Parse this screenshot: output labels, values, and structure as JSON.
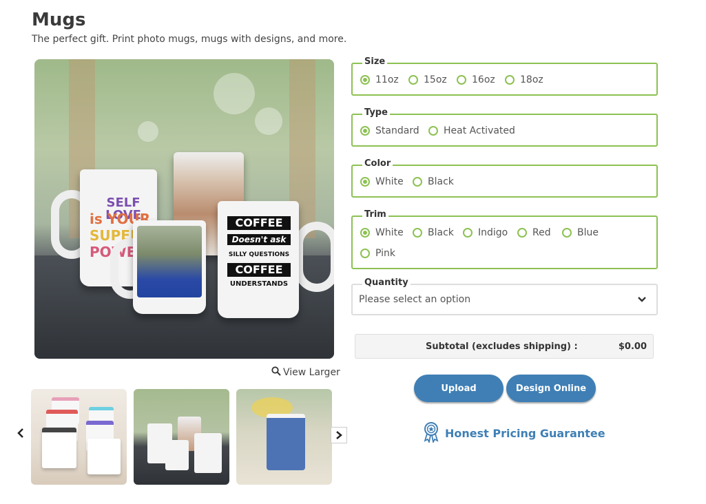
{
  "page": {
    "title": "Mugs",
    "subtitle": "The perfect gift. Print photo mugs, mugs with designs, and more."
  },
  "gallery": {
    "view_larger": "View Larger",
    "main_mug_texts": {
      "self_love": [
        "SELF LOVE",
        "is YOUR",
        "SUPER",
        "POWER"
      ],
      "coffee": [
        "COFFEE",
        "Doesn't ask",
        "SILLY QUESTIONS",
        "COFFEE",
        "UNDERSTANDS"
      ]
    }
  },
  "options": {
    "size": {
      "legend": "Size",
      "items": [
        "11oz",
        "15oz",
        "16oz",
        "18oz"
      ],
      "selected": "11oz"
    },
    "type": {
      "legend": "Type",
      "items": [
        "Standard",
        "Heat Activated"
      ],
      "selected": "Standard"
    },
    "color": {
      "legend": "Color",
      "items": [
        "White",
        "Black"
      ],
      "selected": "White"
    },
    "trim": {
      "legend": "Trim",
      "items": [
        "White",
        "Black",
        "Indigo",
        "Red",
        "Blue",
        "Pink"
      ],
      "selected": "White"
    },
    "quantity": {
      "legend": "Quantity",
      "value": "Please select an option"
    }
  },
  "subtotal": {
    "label": "Subtotal (excludes shipping) :",
    "value": "$0.00"
  },
  "buttons": {
    "upload": "Upload",
    "design_online": "Design Online"
  },
  "guarantee": {
    "label": "Honest Pricing Guarantee"
  },
  "colors": {
    "accent_green": "#8cc152",
    "brand_blue": "#3f7fb5"
  },
  "icons": [
    "search-icon",
    "chevron-down-icon",
    "chevron-left-icon",
    "chevron-right-icon",
    "award-ribbon-icon"
  ]
}
